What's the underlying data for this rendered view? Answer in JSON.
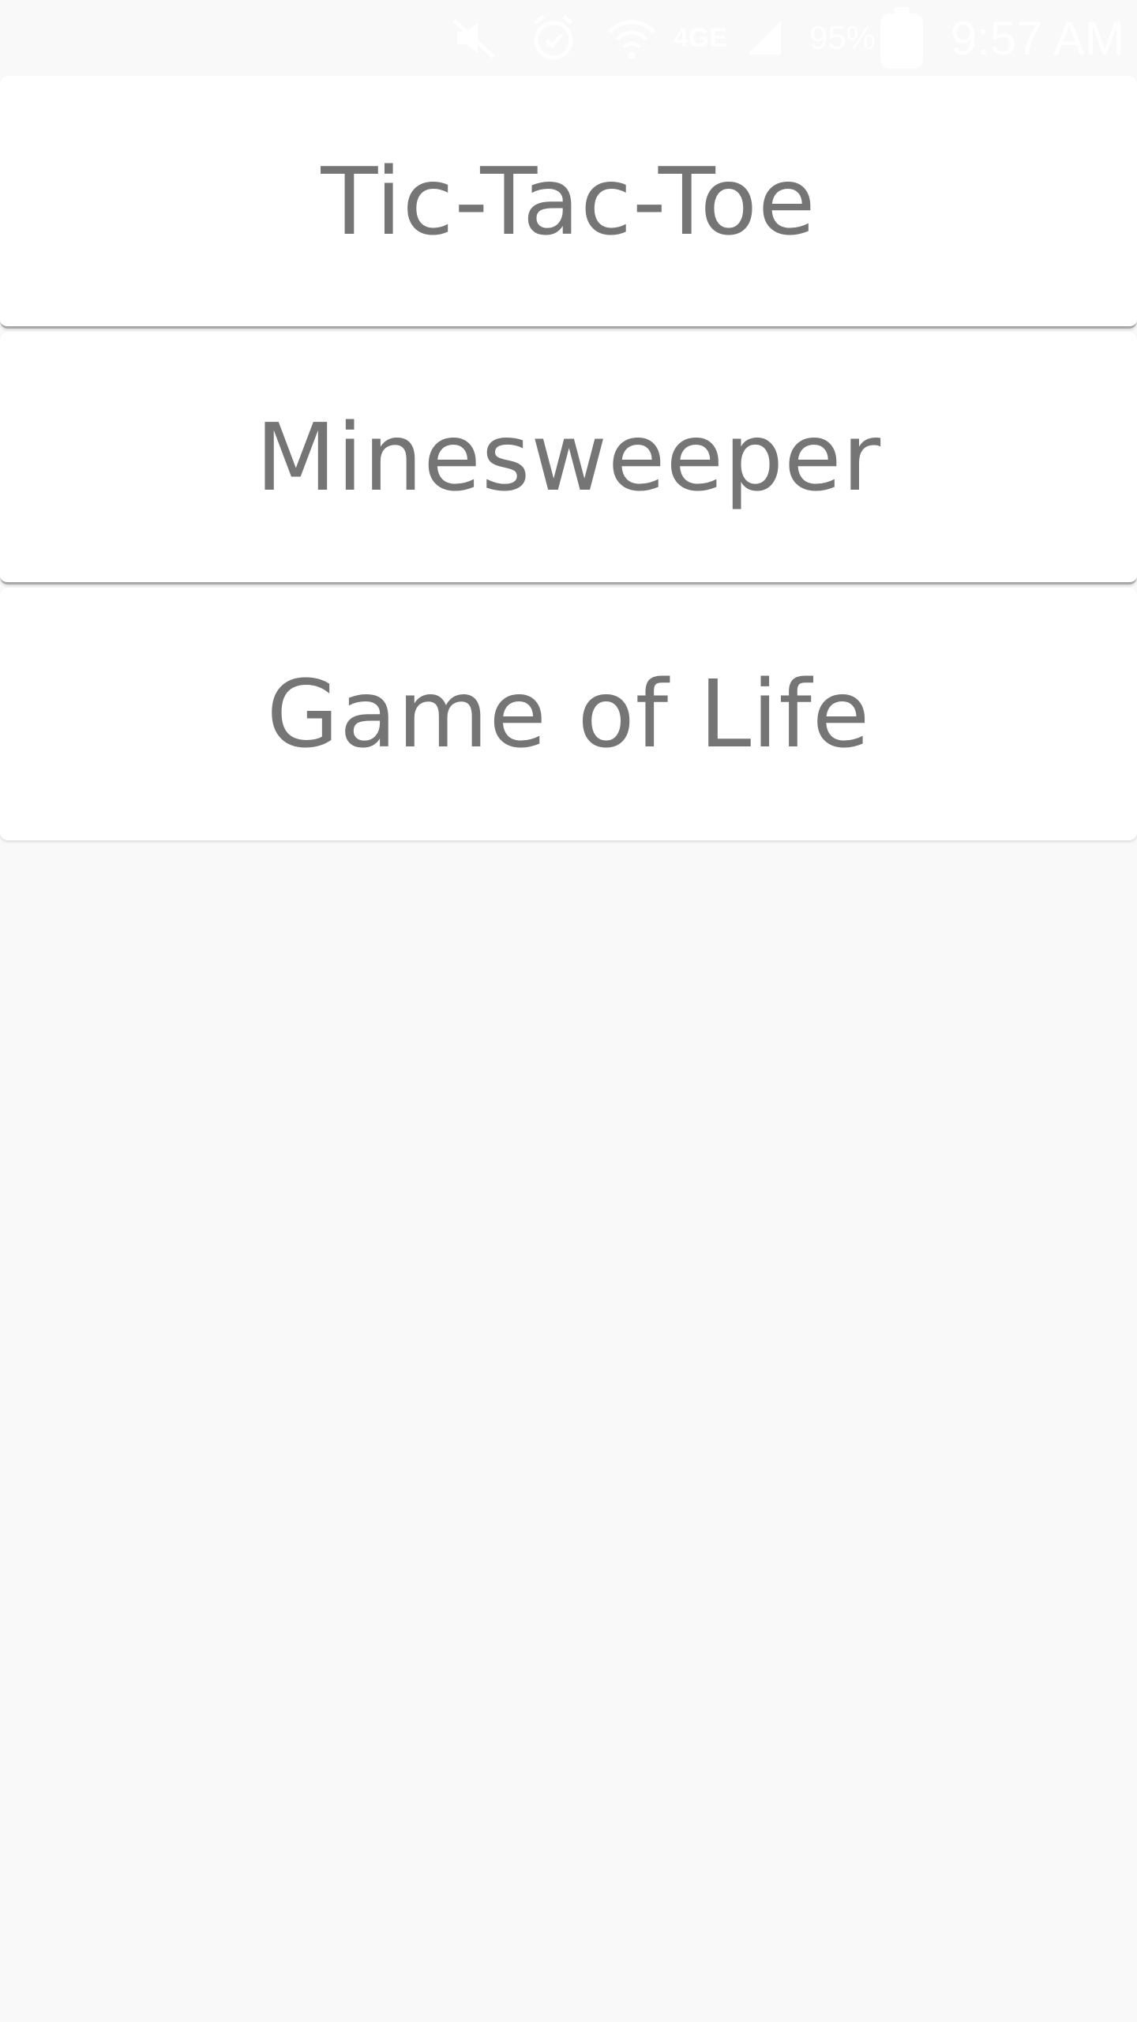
{
  "status_bar": {
    "icons": [
      "mute-icon",
      "alarm-icon",
      "wifi-icon",
      "lte-icon",
      "signal-icon",
      "battery-icon"
    ],
    "network_label": "4GE",
    "battery_percent": "95%",
    "time": "9:57 AM"
  },
  "games": [
    {
      "label": "Tic-Tac-Toe"
    },
    {
      "label": "Minesweeper"
    },
    {
      "label": "Game of Life"
    }
  ],
  "colors": {
    "background": "#f9f9f9",
    "card": "#ffffff",
    "label": "#757575",
    "divider": "#a8a8a8"
  }
}
